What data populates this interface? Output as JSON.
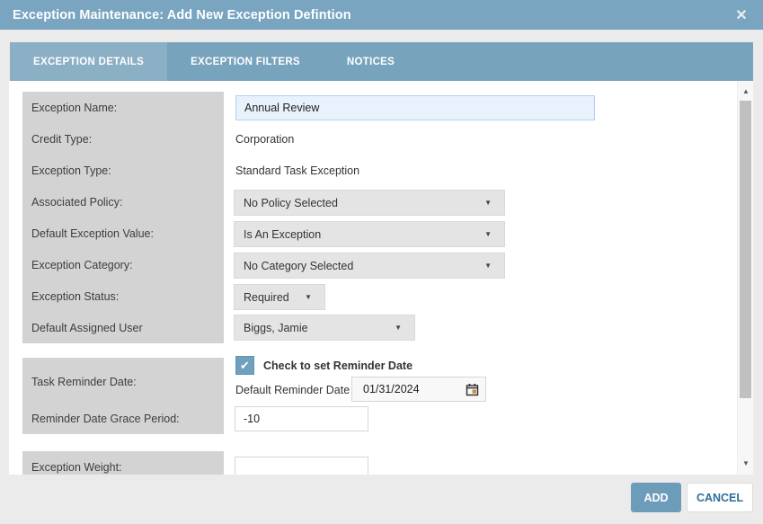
{
  "dialog": {
    "title": "Exception Maintenance: Add New Exception Defintion"
  },
  "icons": {
    "close": "✕",
    "dropdown_arrow": "▼",
    "check": "✔",
    "scroll_up": "▲",
    "scroll_down": "▼"
  },
  "tabs": [
    {
      "label": "EXCEPTION DETAILS",
      "active": true
    },
    {
      "label": "EXCEPTION FILTERS",
      "active": false
    },
    {
      "label": "NOTICES",
      "active": false
    }
  ],
  "form": {
    "exception_name": {
      "label": "Exception Name:",
      "value": "Annual Review"
    },
    "credit_type": {
      "label": "Credit Type:",
      "value": "Corporation"
    },
    "exception_type": {
      "label": "Exception Type:",
      "value": "Standard Task Exception"
    },
    "associated_policy": {
      "label": "Associated Policy:",
      "value": "No Policy Selected"
    },
    "default_exception_value": {
      "label": "Default Exception Value:",
      "value": "Is An Exception"
    },
    "exception_category": {
      "label": "Exception Category:",
      "value": "No Category Selected"
    },
    "exception_status": {
      "label": "Exception Status:",
      "value": "Required"
    },
    "default_assigned_user": {
      "label": "Default Assigned User",
      "value": "Biggs, Jamie"
    },
    "task_reminder_date": {
      "label": "Task Reminder Date:",
      "checkbox_label": "Check to set Reminder Date",
      "checkbox_checked": true,
      "date_label": "Default Reminder Date",
      "date_value": "01/31/2024"
    },
    "reminder_grace_period": {
      "label": "Reminder Date Grace Period:",
      "value": "-10"
    },
    "exception_weight": {
      "label": "Exception Weight:",
      "value": ""
    }
  },
  "footer": {
    "add_label": "ADD",
    "cancel_label": "CANCEL"
  },
  "colors": {
    "titlebar": "#79a5c0",
    "tabstrip": "#78a3bd",
    "active_tab": "#8bafc5",
    "panel_gray": "#d3d3d3",
    "accent_blue": "#6d9cbb",
    "name_input_bg": "#e9f2fc"
  }
}
